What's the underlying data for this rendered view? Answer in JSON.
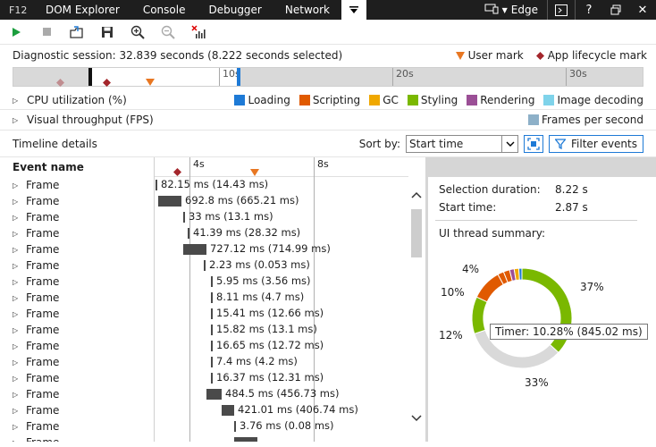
{
  "topbar": {
    "f12": "F12",
    "tabs": [
      "DOM Explorer",
      "Console",
      "Debugger",
      "Network"
    ],
    "browser": "Edge"
  },
  "session": {
    "text": "Diagnostic session: 32.839 seconds (8.222 seconds selected)",
    "legend_user_mark": "User mark",
    "legend_lifecycle": "App lifecycle mark"
  },
  "ruler": {
    "ticks": [
      "10s",
      "20s",
      "30s"
    ]
  },
  "cpu": {
    "title": "CPU utilization (%)",
    "categories": [
      {
        "name": "Loading",
        "color": "#1e7ad6"
      },
      {
        "name": "Scripting",
        "color": "#e05a00"
      },
      {
        "name": "GC",
        "color": "#f0a800"
      },
      {
        "name": "Styling",
        "color": "#7ab800"
      },
      {
        "name": "Rendering",
        "color": "#9b4f96"
      },
      {
        "name": "Image decoding",
        "color": "#7fd3ea"
      }
    ]
  },
  "visual": {
    "title": "Visual throughput (FPS)",
    "legend": "Frames per second",
    "legend_color": "#8db0c8"
  },
  "details": {
    "title": "Timeline details",
    "sort_label": "Sort by:",
    "sort_value": "Start time",
    "filter_label": "Filter events",
    "event_col": "Event name",
    "scale_ticks": [
      "4s",
      "8s"
    ]
  },
  "events": [
    {
      "name": "Frame",
      "label": "82.15 ms (14.43 ms)",
      "start": 0.0,
      "dur": 0.005
    },
    {
      "name": "Frame",
      "label": "692.8 ms (665.21 ms)",
      "start": 0.01,
      "dur": 0.09
    },
    {
      "name": "Frame",
      "label": "33 ms (13.1 ms)",
      "start": 0.11,
      "dur": 0.004
    },
    {
      "name": "Frame",
      "label": "41.39 ms (28.32 ms)",
      "start": 0.125,
      "dur": 0.005
    },
    {
      "name": "Frame",
      "label": "727.12 ms (714.99 ms)",
      "start": 0.11,
      "dur": 0.09
    },
    {
      "name": "Frame",
      "label": "2.23 ms (0.053 ms)",
      "start": 0.19,
      "dur": 0.003
    },
    {
      "name": "Frame",
      "label": "5.95 ms (3.56 ms)",
      "start": 0.22,
      "dur": 0.003
    },
    {
      "name": "Frame",
      "label": "8.11 ms (4.7 ms)",
      "start": 0.22,
      "dur": 0.003
    },
    {
      "name": "Frame",
      "label": "15.41 ms (12.66 ms)",
      "start": 0.22,
      "dur": 0.003
    },
    {
      "name": "Frame",
      "label": "15.82 ms (13.1 ms)",
      "start": 0.22,
      "dur": 0.003
    },
    {
      "name": "Frame",
      "label": "16.65 ms (12.72 ms)",
      "start": 0.22,
      "dur": 0.003
    },
    {
      "name": "Frame",
      "label": "7.4 ms (4.2 ms)",
      "start": 0.22,
      "dur": 0.003
    },
    {
      "name": "Frame",
      "label": "16.37 ms (12.31 ms)",
      "start": 0.22,
      "dur": 0.003
    },
    {
      "name": "Frame",
      "label": "484.5 ms (456.73 ms)",
      "start": 0.2,
      "dur": 0.06
    },
    {
      "name": "Frame",
      "label": "421.01 ms (406.74 ms)",
      "start": 0.26,
      "dur": 0.05
    },
    {
      "name": "Frame",
      "label": "3.76 ms (0.08 ms)",
      "start": 0.31,
      "dur": 0.003
    },
    {
      "name": "Frame",
      "label": "",
      "start": 0.31,
      "dur": 0.09
    }
  ],
  "summary": {
    "selection_label": "Selection duration:",
    "selection_value": "8.22 s",
    "start_label": "Start time:",
    "start_value": "2.87 s",
    "thread_title": "UI thread summary:",
    "tooltip": "Timer: 10.28% (845.02 ms)",
    "labels": [
      "37%",
      "33%",
      "12%",
      "10%",
      "4%"
    ]
  },
  "chart_data": {
    "type": "pie",
    "title": "",
    "slices": [
      {
        "value": 37,
        "color": "#7ab800"
      },
      {
        "value": 33,
        "color": "#d9d9d9"
      },
      {
        "value": 12,
        "color": "#7ab800"
      },
      {
        "value": 10,
        "color": "#e05a00"
      },
      {
        "value": 2,
        "color": "#e05a00"
      },
      {
        "value": 2,
        "color": "#e05a00"
      },
      {
        "value": 1.5,
        "color": "#9b4f96"
      },
      {
        "value": 1.5,
        "color": "#f0a800"
      },
      {
        "value": 1,
        "color": "#1e7ad6"
      }
    ]
  }
}
